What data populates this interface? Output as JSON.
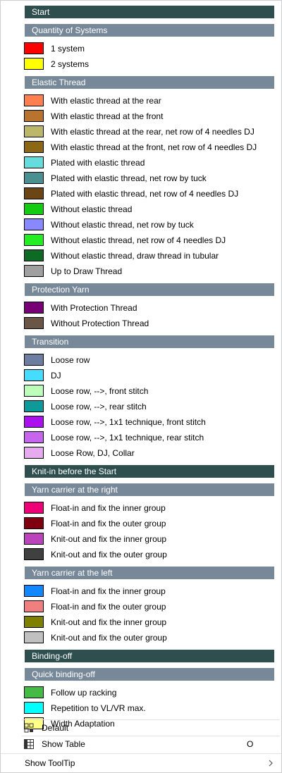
{
  "sections": [
    {
      "type": "header",
      "style": "dark",
      "label": "Start"
    },
    {
      "type": "header",
      "style": "light",
      "label": "Quantity of Systems"
    },
    {
      "type": "item",
      "color": "#ff0000",
      "label": "1 system"
    },
    {
      "type": "item",
      "color": "#ffff00",
      "label": "2 systems"
    },
    {
      "type": "header",
      "style": "light",
      "label": "Elastic Thread"
    },
    {
      "type": "item",
      "color": "#ff7f50",
      "label": "With elastic thread at the rear"
    },
    {
      "type": "item",
      "color": "#b8732f",
      "label": "With elastic thread at the front"
    },
    {
      "type": "item",
      "color": "#bdb76b",
      "label": "With elastic thread at the rear, net row of 4 needles DJ"
    },
    {
      "type": "item",
      "color": "#8b6914",
      "label": "With elastic thread at the front, net row of 4 needles DJ"
    },
    {
      "type": "item",
      "color": "#66dddd",
      "label": "Plated with elastic thread"
    },
    {
      "type": "item",
      "color": "#4a9090",
      "label": "Plated with elastic thread, net row by tuck"
    },
    {
      "type": "item",
      "color": "#6b4513",
      "label": "Plated with elastic thread, net row of 4 needles DJ"
    },
    {
      "type": "item",
      "color": "#11cc11",
      "label": "Without elastic thread"
    },
    {
      "type": "item",
      "color": "#8888ff",
      "label": "Without elastic thread, net row by tuck"
    },
    {
      "type": "item",
      "color": "#22ee22",
      "label": "Without elastic thread, net row of 4 needles DJ"
    },
    {
      "type": "item",
      "color": "#0e6b23",
      "label": "Without elastic thread, draw thread in tubular"
    },
    {
      "type": "item",
      "color": "#a0a0a0",
      "label": "Up to Draw Thread"
    },
    {
      "type": "header",
      "style": "light",
      "label": "Protection Yarn"
    },
    {
      "type": "item",
      "color": "#770077",
      "label": "With Protection Thread"
    },
    {
      "type": "item",
      "color": "#6b5545",
      "label": "Without Protection Thread"
    },
    {
      "type": "header",
      "style": "light",
      "label": "Transition"
    },
    {
      "type": "item",
      "color": "#6e7ea0",
      "label": "Loose row"
    },
    {
      "type": "item",
      "color": "#44ddff",
      "label": "DJ"
    },
    {
      "type": "item",
      "color": "#bbffbb",
      "label": "Loose row, -->, front stitch"
    },
    {
      "type": "item",
      "color": "#0f9a9a",
      "label": "Loose row, -->, rear stitch"
    },
    {
      "type": "item",
      "color": "#aa11ee",
      "label": "Loose row, -->, 1x1 technique, front stitch"
    },
    {
      "type": "item",
      "color": "#c666ee",
      "label": "Loose row, -->, 1x1 technique, rear stitch"
    },
    {
      "type": "item",
      "color": "#e6aaee",
      "label": "Loose Row, DJ, Collar"
    },
    {
      "type": "header",
      "style": "dark",
      "label": "Knit-in before the Start"
    },
    {
      "type": "header",
      "style": "light",
      "label": "Yarn carrier at the right"
    },
    {
      "type": "item",
      "color": "#ee0077",
      "label": "Float-in and fix the inner group"
    },
    {
      "type": "item",
      "color": "#800010",
      "label": "Float-in and fix the outer group"
    },
    {
      "type": "item",
      "color": "#bb44bb",
      "label": "Knit-out and fix the inner group"
    },
    {
      "type": "item",
      "color": "#404040",
      "label": "Knit-out and fix the outer group"
    },
    {
      "type": "header",
      "style": "light",
      "label": "Yarn carrier at the left"
    },
    {
      "type": "item",
      "color": "#1188ff",
      "label": "Float-in and fix the inner group"
    },
    {
      "type": "item",
      "color": "#f08080",
      "label": "Float-in and fix the outer group"
    },
    {
      "type": "item",
      "color": "#808000",
      "label": "Knit-out and fix the inner group"
    },
    {
      "type": "item",
      "color": "#c0c0c0",
      "label": "Knit-out and fix the outer group"
    },
    {
      "type": "header",
      "style": "dark",
      "label": "Binding-off"
    },
    {
      "type": "header",
      "style": "light",
      "label": "Quick binding-off"
    },
    {
      "type": "item",
      "color": "#44bb44",
      "label": "Follow up racking"
    },
    {
      "type": "item",
      "color": "#00ffff",
      "label": "Repetition to VL/VR max."
    },
    {
      "type": "item",
      "color": "#ffff88",
      "label": "Width Adaptation"
    }
  ],
  "commands": {
    "default": {
      "label": "Default",
      "icon": "grid-icon"
    },
    "show_table": {
      "label": "Show Table",
      "icon": "table-icon",
      "shortcut": "O"
    },
    "show_tooltip": {
      "label": "Show ToolTip",
      "icon": "chevron-right-icon"
    }
  }
}
